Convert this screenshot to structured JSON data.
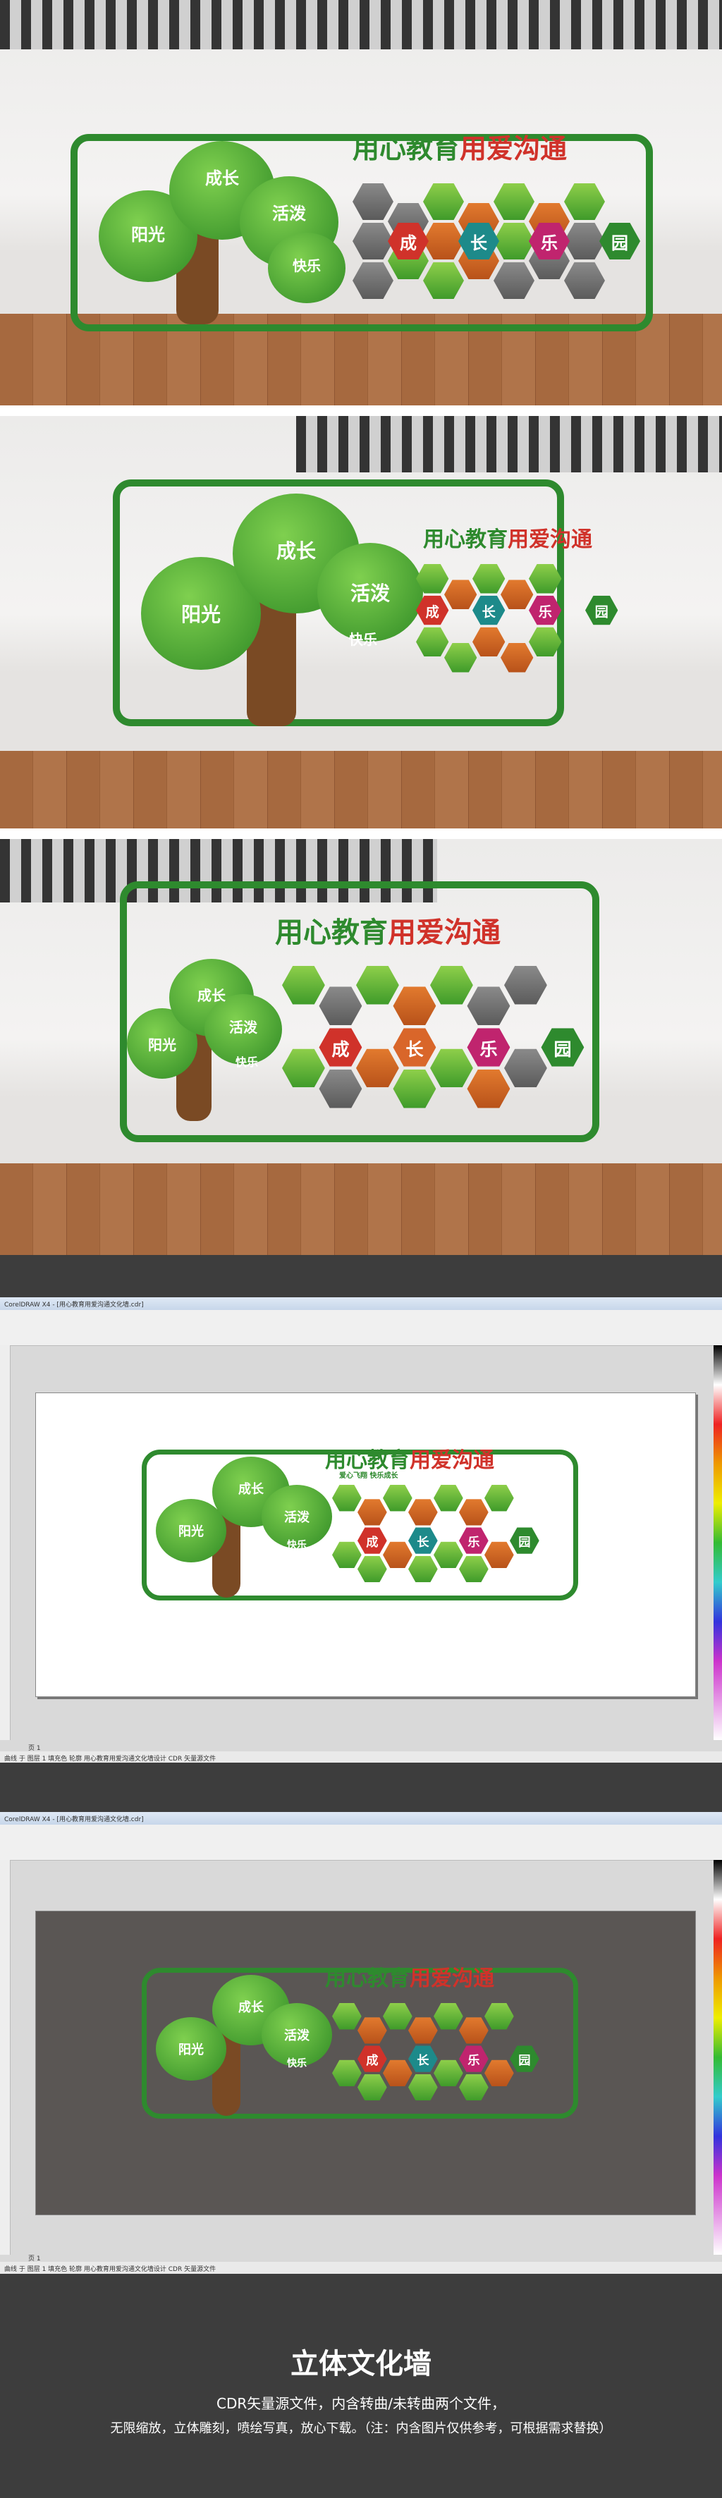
{
  "design": {
    "headline_part1": "用心教育",
    "headline_part2": "用爱沟通",
    "subline": "爱心飞翔  快乐成长",
    "tree_labels": [
      "阳光",
      "成长",
      "活泼",
      "快乐"
    ],
    "hex_labels": [
      "成",
      "长",
      "乐",
      "园"
    ]
  },
  "editor": {
    "titlebar_text": "CorelDRAW X4 - [用心教育用爱沟通文化墙.cdr]",
    "status_text": "曲线 于 图层 1   填充色   轮廓   用心教育用爱沟通文化墙设计 CDR 矢量源文件",
    "page_tab": "页 1"
  },
  "footer": {
    "title": "立体文化墙",
    "line1": "CDR矢量源文件，内含转曲/未转曲两个文件，",
    "line2": "无限缩放，立体雕刻，喷绘写真，放心下载。（注：内含图片仅供参考，可根据需求替换）"
  },
  "colors": {
    "green": "#2e8a2e",
    "orange": "#d9662a",
    "red": "#d0322a",
    "dark_bg": "#3d3d3d",
    "preview_bg": "#5a5654"
  }
}
